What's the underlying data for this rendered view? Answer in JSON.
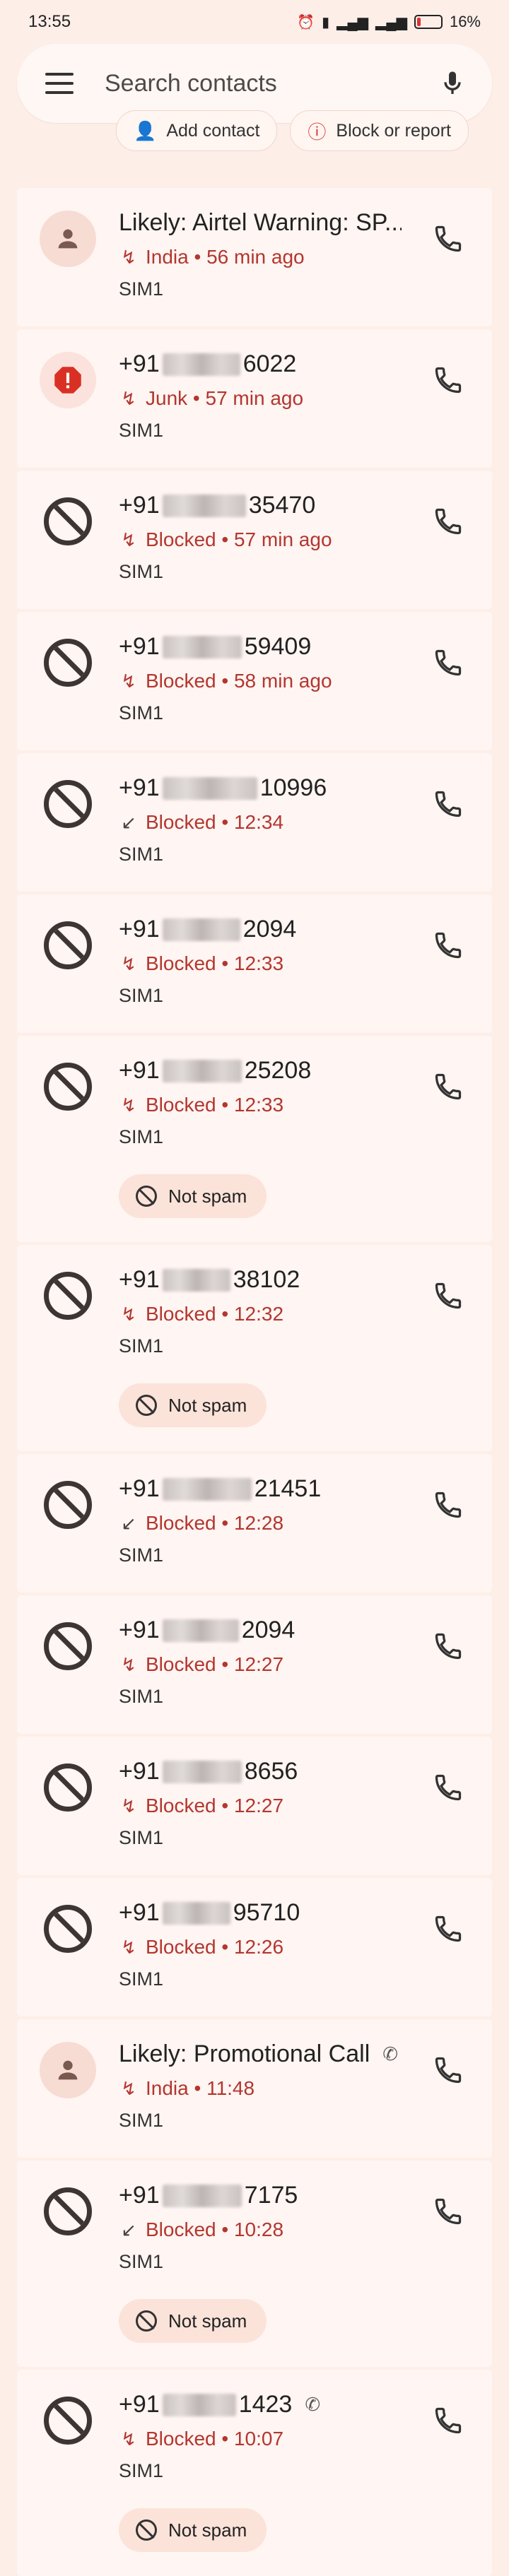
{
  "status": {
    "time": "13:55",
    "battery": "16%",
    "battery_level": 0.16
  },
  "search": {
    "placeholder": "Search contacts"
  },
  "chips": {
    "add_contact": "Add contact",
    "block_report": "Block or report"
  },
  "calls": [
    {
      "name": "Likely: Airtel Warning: SP...",
      "icon": "person",
      "dir": "missed",
      "meta": "India • 56 min ago",
      "sim": "SIM1",
      "not_spam": false
    },
    {
      "prefix": "+91",
      "suffix": "6022",
      "icon": "junk",
      "dir": "missed",
      "meta": "Junk • 57 min ago",
      "sim": "SIM1",
      "not_spam": false
    },
    {
      "prefix": "+91",
      "suffix": "35470",
      "icon": "blocked",
      "dir": "missed",
      "meta": "Blocked • 57 min ago",
      "sim": "SIM1",
      "not_spam": false
    },
    {
      "prefix": "+91",
      "suffix": "59409",
      "icon": "blocked",
      "dir": "missed",
      "meta": "Blocked • 58 min ago",
      "sim": "SIM1",
      "not_spam": false
    },
    {
      "prefix": "+91",
      "suffix": "10996",
      "icon": "blocked",
      "dir": "incoming",
      "meta": "Blocked • 12:34",
      "sim": "SIM1",
      "not_spam": false
    },
    {
      "prefix": "+91",
      "suffix": "2094",
      "icon": "blocked",
      "dir": "missed",
      "meta": "Blocked • 12:33",
      "sim": "SIM1",
      "not_spam": false
    },
    {
      "prefix": "+91",
      "suffix": "25208",
      "icon": "blocked",
      "dir": "missed",
      "meta": "Blocked • 12:33",
      "sim": "SIM1",
      "not_spam": true
    },
    {
      "prefix": "+91",
      "suffix": "38102",
      "icon": "blocked",
      "dir": "missed",
      "meta": "Blocked • 12:32",
      "sim": "SIM1",
      "not_spam": true
    },
    {
      "prefix": "+91",
      "suffix": "21451",
      "icon": "blocked",
      "dir": "incoming",
      "meta": "Blocked • 12:28",
      "sim": "SIM1",
      "not_spam": false
    },
    {
      "prefix": "+91",
      "suffix": "2094",
      "icon": "blocked",
      "dir": "missed",
      "meta": "Blocked • 12:27",
      "sim": "SIM1",
      "not_spam": false
    },
    {
      "prefix": "+91",
      "suffix": "8656",
      "icon": "blocked",
      "dir": "missed",
      "meta": "Blocked • 12:27",
      "sim": "SIM1",
      "not_spam": false
    },
    {
      "prefix": "+91",
      "suffix": "95710",
      "icon": "blocked",
      "dir": "missed",
      "meta": "Blocked • 12:26",
      "sim": "SIM1",
      "not_spam": false
    },
    {
      "name": "Likely: Promotional Call",
      "icon": "person",
      "dir": "missed",
      "meta": "India • 11:48",
      "sim": "SIM1",
      "not_spam": false,
      "wifi": true
    },
    {
      "prefix": "+91",
      "suffix": "7175",
      "icon": "blocked",
      "dir": "incoming",
      "meta": "Blocked • 10:28",
      "sim": "SIM1",
      "not_spam": true
    },
    {
      "prefix": "+91",
      "suffix": "1423",
      "icon": "blocked",
      "dir": "missed",
      "meta": "Blocked • 10:07",
      "sim": "SIM1",
      "not_spam": true,
      "wifi": true
    }
  ],
  "not_spam_label": "Not spam",
  "colors": {
    "background": "#fdeee8",
    "card": "#fff5f2",
    "accent_red": "#b3362f",
    "junk_red": "#d93025"
  }
}
